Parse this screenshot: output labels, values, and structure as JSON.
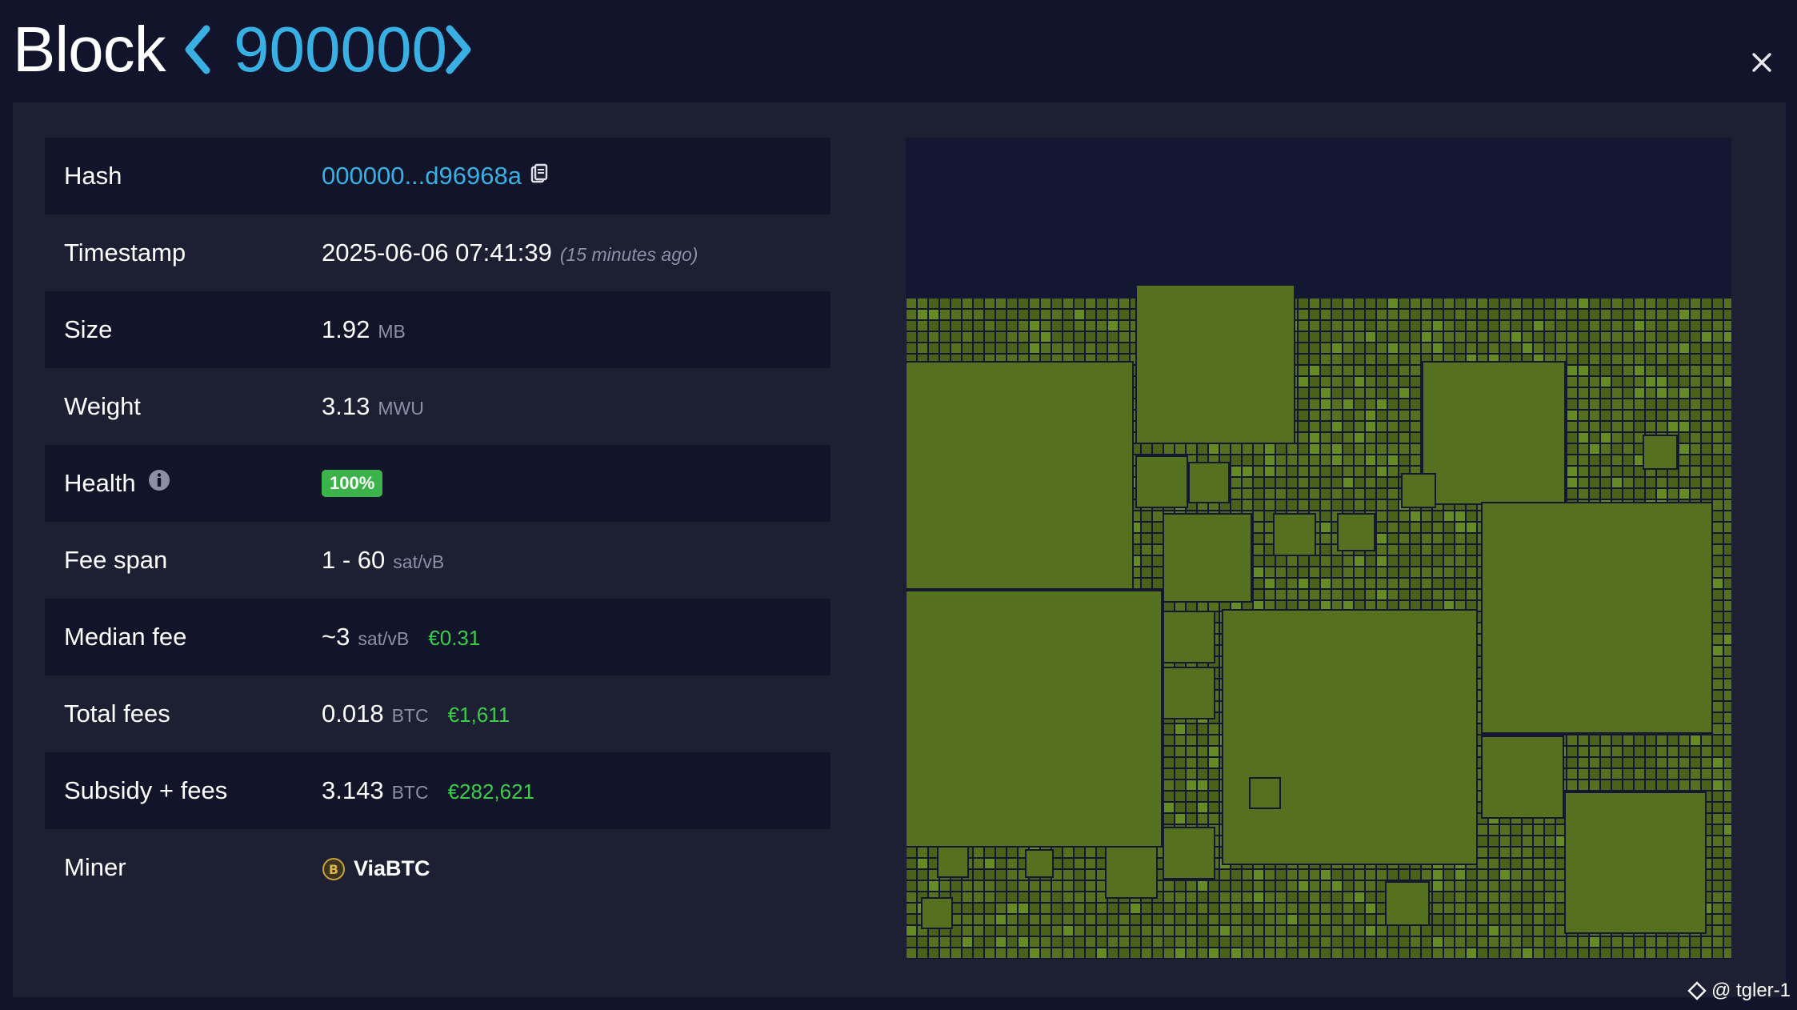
{
  "header": {
    "title": "Block",
    "block_height": "900000"
  },
  "details": {
    "hash": {
      "label": "Hash",
      "value": "000000...d96968a"
    },
    "timestamp": {
      "label": "Timestamp",
      "value": "2025-06-06 07:41:39",
      "relative": "(15 minutes ago)"
    },
    "size": {
      "label": "Size",
      "value": "1.92",
      "unit": "MB"
    },
    "weight": {
      "label": "Weight",
      "value": "3.13",
      "unit": "MWU"
    },
    "health": {
      "label": "Health",
      "value": "100%"
    },
    "fee_span": {
      "label": "Fee span",
      "value": "1 - 60",
      "unit": "sat/vB"
    },
    "median_fee": {
      "label": "Median fee",
      "value": "~3",
      "unit": "sat/vB",
      "fiat": "€0.31"
    },
    "total_fees": {
      "label": "Total fees",
      "value": "0.018",
      "unit": "BTC",
      "fiat": "€1,611"
    },
    "subsidy_fees": {
      "label": "Subsidy + fees",
      "value": "3.143",
      "unit": "BTC",
      "fiat": "€282,621"
    },
    "miner": {
      "label": "Miner",
      "value": "ViaBTC"
    }
  },
  "icons": {
    "prev": "chevron-left-icon",
    "next": "chevron-right-icon",
    "close": "close-icon",
    "copy": "clipboard-icon",
    "info": "info-icon",
    "miner": "coin-icon"
  },
  "colors": {
    "accent": "#39b0e3",
    "health": "#3bb24a",
    "fiat": "#3bcc49",
    "tx_block": "#55701e",
    "tx_block_light": "#668a24"
  },
  "watermark": "@ tgler-1"
}
